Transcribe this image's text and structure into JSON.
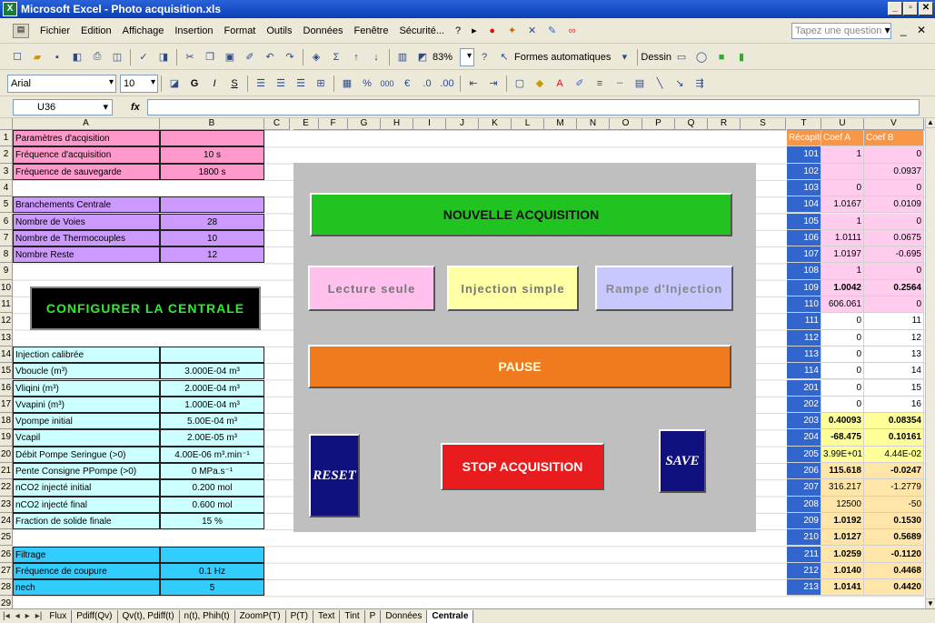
{
  "window": {
    "title": "Microsoft Excel - Photo acquisition.xls",
    "app_icon": "X",
    "buttons": [
      "_",
      "▫",
      "✕"
    ]
  },
  "menu": {
    "items": [
      "Fichier",
      "Edition",
      "Affichage",
      "Insertion",
      "Format",
      "Outils",
      "Données",
      "Fenêtre",
      "Sécurité...",
      "?"
    ],
    "question_placeholder": "Tapez une question"
  },
  "toolbar": {
    "zoom": "83%",
    "autoshapes": "Formes automatiques",
    "draw": "Dessin"
  },
  "format": {
    "font": "Arial",
    "size": "10",
    "bold": "G",
    "italic": "I",
    "underline": "S",
    "percent": "%",
    "thousands": "000",
    "euro": "€"
  },
  "formula": {
    "cell_ref": "U36",
    "fx": "fx"
  },
  "columns": [
    "A",
    "B",
    "C",
    "D",
    "E",
    "F",
    "G",
    "H",
    "I",
    "J",
    "K",
    "L",
    "M",
    "N",
    "O",
    "P",
    "Q",
    "R",
    "S",
    "T",
    "U",
    "V"
  ],
  "rows": [
    "1",
    "2",
    "3",
    "4",
    "5",
    "6",
    "7",
    "8",
    "9",
    "10",
    "11",
    "12",
    "13",
    "14",
    "15",
    "16",
    "17",
    "18",
    "19",
    "20",
    "21",
    "22",
    "23",
    "24",
    "25",
    "26",
    "27",
    "28",
    "29"
  ],
  "left_table": [
    {
      "r": 1,
      "a": "Paramètres d'acqisition",
      "b": "",
      "bg": "#ff99cc"
    },
    {
      "r": 2,
      "a": "Fréquence d'acquisition",
      "b": "10 s",
      "bg": "#ff99cc"
    },
    {
      "r": 3,
      "a": "Fréquence de sauvegarde",
      "b": "1800 s",
      "bg": "#ff99cc"
    },
    {
      "r": 5,
      "a": "Branchements Centrale",
      "b": "",
      "bg": "#cc99ff"
    },
    {
      "r": 6,
      "a": "Nombre de Voies",
      "b": "28",
      "bg": "#cc99ff"
    },
    {
      "r": 7,
      "a": "Nombre de Thermocouples",
      "b": "10",
      "bg": "#cc99ff"
    },
    {
      "r": 8,
      "a": "Nombre Reste",
      "b": "12",
      "bg": "#cc99ff"
    },
    {
      "r": 14,
      "a": "Injection calibrée",
      "b": "",
      "bg": "#ccffff"
    },
    {
      "r": 15,
      "a": "Vboucle (m³)",
      "b": "3.000E-04 m³",
      "bg": "#ccffff"
    },
    {
      "r": 16,
      "a": "Vliqini (m³)",
      "b": "2.000E-04 m³",
      "bg": "#ccffff"
    },
    {
      "r": 17,
      "a": "Vvapini (m³)",
      "b": "1.000E-04 m³",
      "bg": "#ccffff"
    },
    {
      "r": 18,
      "a": "Vpompe initial",
      "b": "5.00E-04 m³",
      "bg": "#ccffff"
    },
    {
      "r": 19,
      "a": "Vcapil",
      "b": "2.00E-05 m³",
      "bg": "#ccffff"
    },
    {
      "r": 20,
      "a": "Débit Pompe Seringue (>0)",
      "b": "4.00E-06 m³.min⁻¹",
      "bg": "#ccffff"
    },
    {
      "r": 21,
      "a": "Pente Consigne PPompe (>0)",
      "b": "0 MPa.s⁻¹",
      "bg": "#ccffff"
    },
    {
      "r": 22,
      "a": "nCO2 injecté initial",
      "b": "0.200 mol",
      "bg": "#ccffff"
    },
    {
      "r": 23,
      "a": "nCO2 injecté final",
      "b": "0.600 mol",
      "bg": "#ccffff"
    },
    {
      "r": 24,
      "a": "Fraction de solide finale",
      "b": "15 %",
      "bg": "#ccffff"
    },
    {
      "r": 26,
      "a": "Filtrage",
      "b": "",
      "bg": "#33ccff"
    },
    {
      "r": 27,
      "a": "Fréquence de coupure",
      "b": "0.1 Hz",
      "bg": "#33ccff"
    },
    {
      "r": 28,
      "a": "nech",
      "b": "5",
      "bg": "#33ccff"
    }
  ],
  "right_table": {
    "header": [
      "Récapitul",
      "Coef A",
      "Coef B"
    ],
    "rows": [
      [
        "101",
        "1",
        "0"
      ],
      [
        "102",
        "",
        "0.0937"
      ],
      [
        "103",
        "0",
        "0"
      ],
      [
        "104",
        "1.0167",
        "0.0109"
      ],
      [
        "105",
        "1",
        "0"
      ],
      [
        "106",
        "1.0111",
        "0.0675"
      ],
      [
        "107",
        "1.0197",
        "-0.695"
      ],
      [
        "108",
        "1",
        "0"
      ],
      [
        "109",
        "1.0042",
        "0.2564"
      ],
      [
        "110",
        "606.061",
        "0"
      ],
      [
        "111",
        "0",
        "11"
      ],
      [
        "112",
        "0",
        "12"
      ],
      [
        "113",
        "0",
        "13"
      ],
      [
        "114",
        "0",
        "14"
      ],
      [
        "201",
        "0",
        "15"
      ],
      [
        "202",
        "0",
        "16"
      ],
      [
        "203",
        "0.40093",
        "0.08354"
      ],
      [
        "204",
        "-68.475",
        "0.10161"
      ],
      [
        "205",
        "3.99E+01",
        "4.44E-02"
      ],
      [
        "206",
        "115.618",
        "-0.0247"
      ],
      [
        "207",
        "316.217",
        "-1.2779"
      ],
      [
        "208",
        "12500",
        "-50"
      ],
      [
        "209",
        "1.0192",
        "0.1530"
      ],
      [
        "210",
        "1.0127",
        "0.5689"
      ],
      [
        "211",
        "1.0259",
        "-0.1120"
      ],
      [
        "212",
        "1.0140",
        "0.4468"
      ],
      [
        "213",
        "1.0141",
        "0.4420"
      ]
    ]
  },
  "buttons": {
    "configure": "CONFIGURER LA CENTRALE",
    "new_acq": "NOUVELLE ACQUISITION",
    "read_only": "Lecture seule",
    "injection": "Injection simple",
    "ramp": "Rampe d'Injection",
    "pause": "PAUSE",
    "reset": "RESET",
    "stop": "STOP ACQUISITION",
    "save": "SAVE"
  },
  "sheets": [
    "Flux",
    "Pdiff(Qv)",
    "Qv(t), Pdiff(t)",
    "n(t), Phih(t)",
    "ZoomP(T)",
    "P(T)",
    "Text",
    "Tint",
    "P",
    "Données",
    "Centrale"
  ],
  "active_sheet": "Centrale"
}
